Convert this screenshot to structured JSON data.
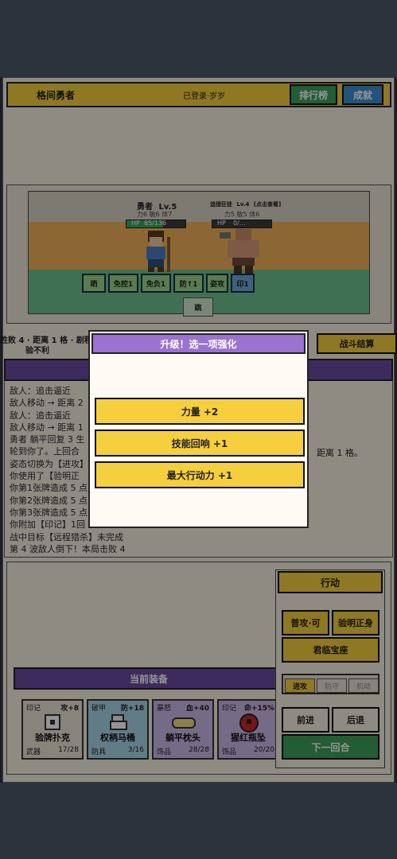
{
  "header": {
    "title": "格间勇者",
    "login_status": "已登录·岁岁",
    "leaderboard_label": "排行榜",
    "achievements_label": "成就"
  },
  "battle": {
    "hero": {
      "name": "勇者",
      "level": "Lv.5",
      "stats": "力6 敏6 体7",
      "hp_label": "HP",
      "hp_text": "85/136",
      "hp_fraction": 0.625
    },
    "enemy": {
      "name": "追猎狂徒",
      "level": "Lv.4",
      "inspect": "[点击查看]",
      "stats": "力5 敏5 体6",
      "hp_label": "HP",
      "hp_text": "0/…",
      "hp_fraction": 0.0
    },
    "skills": [
      "晒",
      "免控1",
      "免负1",
      "防↑1",
      "姿攻",
      "印1"
    ],
    "center_button": "跳"
  },
  "status": {
    "line1": "胜败 4 · 距离 1 格 · 剧程 3",
    "line2": "验不利",
    "settle_label": "战斗结算"
  },
  "log": {
    "lines": [
      "敌人：追击逼近",
      "敌人移动 → 距离 2",
      "敌人：追击逼近",
      "敌人移动 → 距离 1",
      "勇者 躺平回复 3 生",
      "轮到你了。上回合",
      "姿态切换为【进攻】",
      "你使用了【验明正",
      "你第1张牌造成 5 点",
      "你第2张牌造成 5 点",
      "你第3张牌造成 5 点",
      "你附加【印记】1回",
      "战中目标【远程猎杀】未完成",
      "第 4 波敌人倒下！本局击败 4"
    ],
    "side_note": "距离 1 格。"
  },
  "equipment": {
    "title": "当前装备",
    "items": [
      {
        "tag": "印记",
        "bonus": "攻+8",
        "name": "验牌扑克",
        "type": "武器",
        "count": "17/28",
        "color": "#e9e3d6"
      },
      {
        "tag": "破甲",
        "bonus": "防+18",
        "name": "权柄马桶",
        "type": "防具",
        "count": "3/16",
        "color": "#a9d6e8"
      },
      {
        "tag": "暴怒",
        "bonus": "血+40",
        "name": "躺平枕头",
        "type": "饰品",
        "count": "28/28",
        "color": "#c9b8e8"
      },
      {
        "tag": "印记",
        "bonus": "命+15%",
        "name": "猩红瓶坠",
        "type": "饰品",
        "count": "20/20",
        "color": "#c9b8e8"
      }
    ]
  },
  "actions": {
    "title": "行动",
    "normal_attack": "普攻·可",
    "verify": "验明正身",
    "treasure": "君临宝座",
    "stances": [
      "进攻",
      "防守",
      "机动"
    ],
    "forward": "前进",
    "back": "后退",
    "next_round": "下一回合"
  },
  "modal": {
    "title": "升级！选一项强化",
    "options": [
      "力量 +2",
      "技能回响 +1",
      "最大行动力 +1"
    ]
  },
  "colors": {
    "background": "#2d333d",
    "gold": "#f6cf3e",
    "purple_header": "#9b72cf",
    "green_button": "#3ca05a",
    "blue_button": "#3d8fd4",
    "modal_bg": "#fdfbf3"
  }
}
